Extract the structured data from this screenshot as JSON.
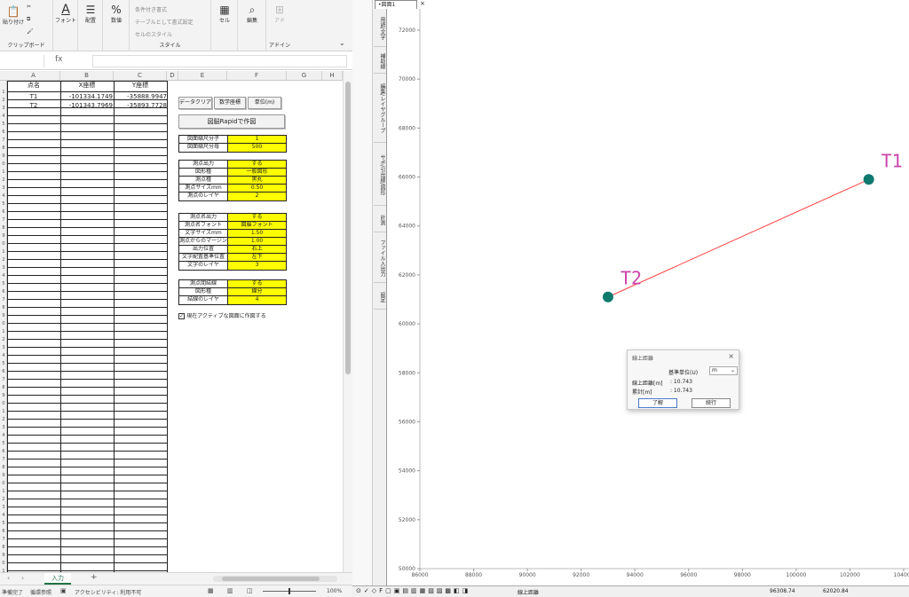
{
  "ribbon": {
    "clipboard_paste": "貼り付け",
    "clipboard_group": "クリップボード",
    "font": "フォント",
    "align": "配置",
    "number": "数値",
    "cond_format": "条件付き書式",
    "table_format": "テーブルとして書式設定",
    "cell_style": "セルのスタイル",
    "style_group": "スタイル",
    "cells": "セル",
    "edit": "編集",
    "addin": "アドイン",
    "addin_top": "アド"
  },
  "formula_bar": {
    "fx": "fx",
    "value": ""
  },
  "columns": [
    "A",
    "B",
    "C",
    "D",
    "E",
    "F",
    "G",
    "H"
  ],
  "sheet": {
    "headers": [
      "点名",
      "X座標",
      "Y座標"
    ],
    "rows": [
      {
        "name": "T1",
        "x": "-101334.1749",
        "y": "-35888.9947"
      },
      {
        "name": "T2",
        "x": "-101343.7969",
        "y": "-35893.7728"
      }
    ],
    "row_numbers": [
      "",
      "1",
      "2",
      "3",
      "4",
      "5",
      "6",
      "7",
      "8",
      "9",
      "0",
      "1",
      "2",
      "3",
      "4",
      "5",
      "6",
      "7",
      "8",
      "9",
      "0",
      "1",
      "2",
      "3",
      "4",
      "5",
      "6",
      "7",
      "8",
      "9",
      "0",
      "1",
      "2",
      "3",
      "4",
      "5",
      "6",
      "7",
      "8",
      "9",
      "0",
      "1",
      "2",
      "3",
      "4",
      "5",
      "6",
      "7",
      "8",
      "9",
      "0",
      "1",
      "2",
      "3",
      "4",
      "5",
      "6",
      "7",
      "8",
      "9",
      "0",
      "1",
      "2"
    ]
  },
  "buttons": {
    "data_clear": "データクリア",
    "math_coord": "数学座標",
    "unit": "単位(m)",
    "draw": "図脳Rapidで作図"
  },
  "params": {
    "scale": [
      [
        "図面縮尺分子",
        "1"
      ],
      [
        "図面縮尺分母",
        "500"
      ]
    ],
    "points": [
      [
        "測点出力",
        "する"
      ],
      [
        "図形種",
        "一般図形"
      ],
      [
        "測点種",
        "黒丸"
      ],
      [
        "測点サイズmm",
        "0.50"
      ],
      [
        "測点のレイヤ",
        "2"
      ]
    ],
    "labels": [
      [
        "測点名出力",
        "する"
      ],
      [
        "測点名フォント",
        "図脳フォント"
      ],
      [
        "文字サイズmm",
        "1.50"
      ],
      [
        "測点からのマージンmm",
        "1.00"
      ],
      [
        "出力位置",
        "右上"
      ],
      [
        "文字配置基準位置",
        "左下"
      ],
      [
        "文字のレイヤ",
        "3"
      ]
    ],
    "lines": [
      [
        "測点間結線",
        "する"
      ],
      [
        "図形種",
        "線分"
      ],
      [
        "結線のレイヤ",
        "4"
      ]
    ]
  },
  "checkbox": {
    "label": "現在アクティブな図面に作図する",
    "checked": true
  },
  "sheet_tab": {
    "active": "入力",
    "add": "+"
  },
  "status": {
    "ready": "準備完了",
    "circ": "循環参照",
    "access": "アクセシビリティ: 利用不可",
    "zoom": "100%"
  },
  "cad": {
    "tab": "•図面1",
    "side_tabs": [
      "用語/文字",
      "補助線",
      "編集/レイヤグループ",
      "サポ/引出線/図形",
      "計測",
      "ファイル入出力",
      "設定"
    ],
    "y_ticks": [
      "72000",
      "70000",
      "68000",
      "66000",
      "64000",
      "62000",
      "60000",
      "58000",
      "56000",
      "54000",
      "52000",
      "50000"
    ],
    "x_ticks": [
      "86000",
      "88000",
      "90000",
      "92000",
      "94000",
      "96000",
      "98000",
      "100000",
      "102000",
      "104000"
    ],
    "points": [
      {
        "label": "T1",
        "x": 102700,
        "y": 65900
      },
      {
        "label": "T2",
        "x": 93000,
        "y": 61100
      }
    ],
    "status_label": "線上距離",
    "coord_x": "96308.74",
    "coord_y": "62020.84",
    "line_color": "#ff4040",
    "point_color": "#0e7a6e",
    "label_color": "#cc44aa"
  },
  "dialog": {
    "title": "線上距離",
    "unit_label": "基準単位(U)",
    "unit_value": "m",
    "dist_label": "線上距離[m]",
    "dist_value": ": 10.743",
    "total_label": "累計[m]",
    "total_value": ": 10.743",
    "ok": "了解",
    "next": "続行"
  }
}
